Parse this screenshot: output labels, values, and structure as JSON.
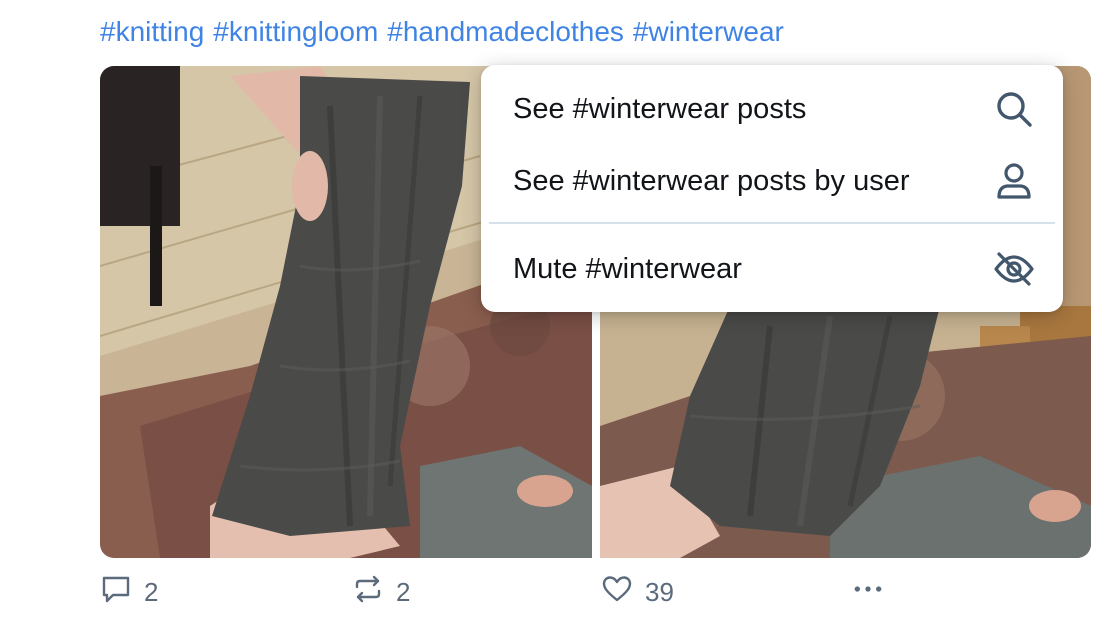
{
  "hashtags": [
    "#knitting",
    "#knittingloom",
    "#handmadeclothes",
    "#winterwear"
  ],
  "images": [
    {
      "subject": "knitted fingerless glove on arm",
      "icon": "photo"
    },
    {
      "subject": "knitted fingerless glove on arm, second view",
      "icon": "photo"
    }
  ],
  "actions": {
    "reply_count": "2",
    "repost_count": "2",
    "like_count": "39"
  },
  "menu": {
    "items": [
      {
        "label": "See #winterwear posts",
        "icon": "search-icon"
      },
      {
        "label": "See #winterwear posts by user",
        "icon": "user-icon"
      },
      {
        "label": "Mute #winterwear",
        "icon": "eye-slash-icon"
      }
    ]
  },
  "colors": {
    "link": "#3f84e5",
    "action_gray": "#5b6b7c",
    "menu_text": "#111418",
    "menu_icon": "#42576c"
  }
}
